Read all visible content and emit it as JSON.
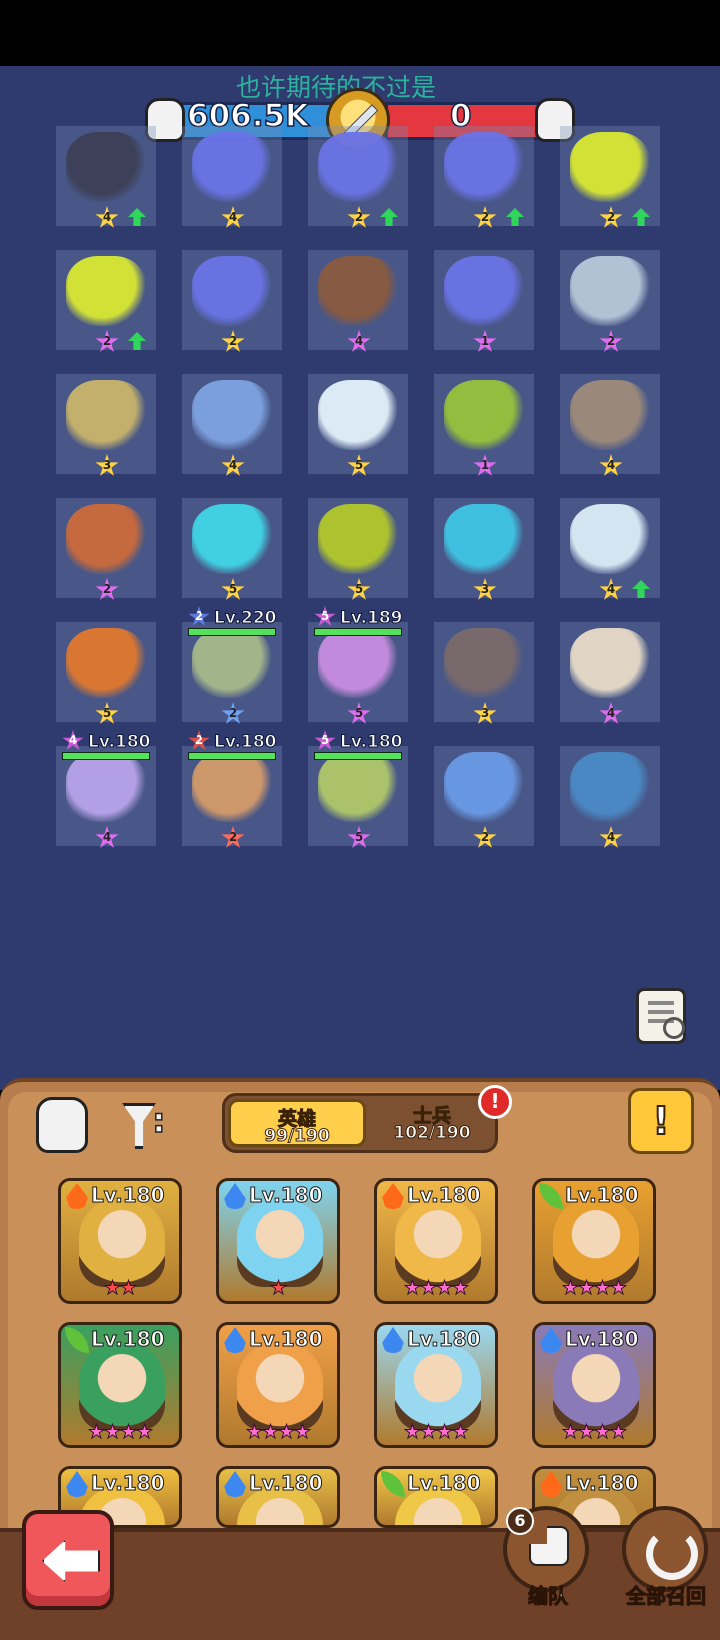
{
  "overlay_text": "也许期待的不过是",
  "power": {
    "ally": "606.5K",
    "enemy": "0"
  },
  "grid": [
    {
      "row": 0,
      "col": 0,
      "stars": "4",
      "color": "#3c3f55",
      "upgrade": true
    },
    {
      "row": 0,
      "col": 1,
      "stars": "4",
      "color": "#6a73e6",
      "upgrade": false
    },
    {
      "row": 0,
      "col": 2,
      "stars": "2",
      "color": "#6a73e6",
      "upgrade": true
    },
    {
      "row": 0,
      "col": 3,
      "stars": "2",
      "color": "#6a73e6",
      "upgrade": true
    },
    {
      "row": 0,
      "col": 4,
      "stars": "2",
      "color": "#d9e832",
      "upgrade": true
    },
    {
      "row": 1,
      "col": 0,
      "stars": "2",
      "color": "#d9e832",
      "upgrade": true,
      "purple": true
    },
    {
      "row": 1,
      "col": 1,
      "stars": "2",
      "color": "#6a73e6",
      "upgrade": false
    },
    {
      "row": 1,
      "col": 2,
      "stars": "4",
      "color": "#8a5a3e",
      "upgrade": false,
      "purple": true
    },
    {
      "row": 1,
      "col": 3,
      "stars": "1",
      "color": "#6a73e6",
      "upgrade": false,
      "purple": true
    },
    {
      "row": 1,
      "col": 4,
      "stars": "2",
      "color": "#b7c7d8",
      "upgrade": false,
      "purple": true
    },
    {
      "row": 2,
      "col": 0,
      "stars": "3",
      "color": "#c9b46a",
      "upgrade": false
    },
    {
      "row": 2,
      "col": 1,
      "stars": "4",
      "color": "#7ea2e0",
      "upgrade": false
    },
    {
      "row": 2,
      "col": 2,
      "stars": "5",
      "color": "#e4f2fb",
      "upgrade": false
    },
    {
      "row": 2,
      "col": 3,
      "stars": "1",
      "color": "#96c23a",
      "upgrade": false,
      "purple": true
    },
    {
      "row": 2,
      "col": 4,
      "stars": "4",
      "color": "#9e8a7a",
      "upgrade": false
    },
    {
      "row": 3,
      "col": 0,
      "stars": "2",
      "color": "#cc6a3a",
      "upgrade": false,
      "purple": true
    },
    {
      "row": 3,
      "col": 1,
      "stars": "5",
      "color": "#40d6e6",
      "upgrade": false
    },
    {
      "row": 3,
      "col": 2,
      "stars": "5",
      "color": "#b2c82a",
      "upgrade": false
    },
    {
      "row": 3,
      "col": 3,
      "stars": "3",
      "color": "#40c6e6",
      "upgrade": false
    },
    {
      "row": 3,
      "col": 4,
      "stars": "4",
      "color": "#dcecf6",
      "upgrade": true
    },
    {
      "row": 4,
      "col": 0,
      "stars": "5",
      "color": "#e0782e",
      "upgrade": false
    },
    {
      "row": 4,
      "col": 1,
      "stars": "2",
      "color": "#a7b98a",
      "upgrade": false,
      "blue": true
    },
    {
      "row": 4,
      "col": 2,
      "stars": "5",
      "color": "#c98de0",
      "upgrade": false,
      "purple": true
    },
    {
      "row": 4,
      "col": 3,
      "stars": "3",
      "color": "#7a6a6a",
      "upgrade": false
    },
    {
      "row": 4,
      "col": 4,
      "stars": "4",
      "color": "#e8dcc8",
      "upgrade": false,
      "purple": true
    },
    {
      "row": 5,
      "col": 0,
      "stars": "4",
      "color": "#b9a3ea",
      "upgrade": false,
      "purple": true
    },
    {
      "row": 5,
      "col": 1,
      "stars": "2",
      "color": "#d49a6a",
      "upgrade": false,
      "red": true
    },
    {
      "row": 5,
      "col": 2,
      "stars": "5",
      "color": "#b0c86a",
      "upgrade": false,
      "purple": true
    },
    {
      "row": 5,
      "col": 3,
      "stars": "2",
      "color": "#6a9ae6",
      "upgrade": false
    },
    {
      "row": 5,
      "col": 4,
      "stars": "4",
      "color": "#4a8ac6",
      "upgrade": false
    }
  ],
  "hero_tags": [
    {
      "row": 4,
      "col": 1,
      "star": "2",
      "star_color": "#5b7be0",
      "level": "Lv.220",
      "hp": 1.0
    },
    {
      "row": 4,
      "col": 2,
      "star": "5",
      "star_color": "#c75bd6",
      "level": "Lv.189",
      "hp": 1.0
    },
    {
      "row": 5,
      "col": 0,
      "star": "4",
      "star_color": "#c75bd6",
      "level": "Lv.180",
      "hp": 1.0
    },
    {
      "row": 5,
      "col": 1,
      "star": "2",
      "star_color": "#e0504a",
      "level": "Lv.180",
      "hp": 1.0
    },
    {
      "row": 5,
      "col": 2,
      "star": "5",
      "star_color": "#c75bd6",
      "level": "Lv.180",
      "hp": 1.0
    }
  ],
  "tabs": {
    "heroes": {
      "label": "英雄",
      "count": "99/190"
    },
    "soldiers": {
      "label": "士兵",
      "count": "102/190"
    },
    "alert": "!"
  },
  "info_button": "!",
  "cards": [
    {
      "level": "Lv.180",
      "element": "fire",
      "stars": "★★",
      "star_style": "red",
      "color": "#e0b040"
    },
    {
      "level": "Lv.180",
      "element": "water",
      "stars": "★",
      "star_style": "red",
      "color": "#7ed4f0"
    },
    {
      "level": "Lv.180",
      "element": "fire",
      "stars": "★★★★",
      "star_style": "pink",
      "color": "#f0b848"
    },
    {
      "level": "Lv.180",
      "element": "nature",
      "stars": "★★★★",
      "star_style": "pink",
      "color": "#e8a030"
    },
    {
      "level": "Lv.180",
      "element": "nature",
      "stars": "★★★★",
      "star_style": "pink",
      "color": "#3aa060"
    },
    {
      "level": "Lv.180",
      "element": "water",
      "stars": "★★★★",
      "star_style": "pink",
      "color": "#f0a048"
    },
    {
      "level": "Lv.180",
      "element": "water",
      "stars": "★★★★",
      "star_style": "pink",
      "color": "#9ad8f0"
    },
    {
      "level": "Lv.180",
      "element": "water",
      "stars": "★★★★",
      "star_style": "pink",
      "color": "#8a7ab8"
    },
    {
      "level": "Lv.180",
      "element": "water",
      "stars": "",
      "star_style": "pink",
      "color": "#f0c040"
    },
    {
      "level": "Lv.180",
      "element": "water",
      "stars": "",
      "star_style": "pink",
      "color": "#e8c048"
    },
    {
      "level": "Lv.180",
      "element": "nature",
      "stars": "",
      "star_style": "pink",
      "color": "#f0c848"
    },
    {
      "level": "Lv.180",
      "element": "fire",
      "stars": "",
      "star_style": "pink",
      "color": "#c09040"
    }
  ],
  "bottom": {
    "team_count": "6",
    "team_label": "编队",
    "recall_label": "全部召回"
  }
}
